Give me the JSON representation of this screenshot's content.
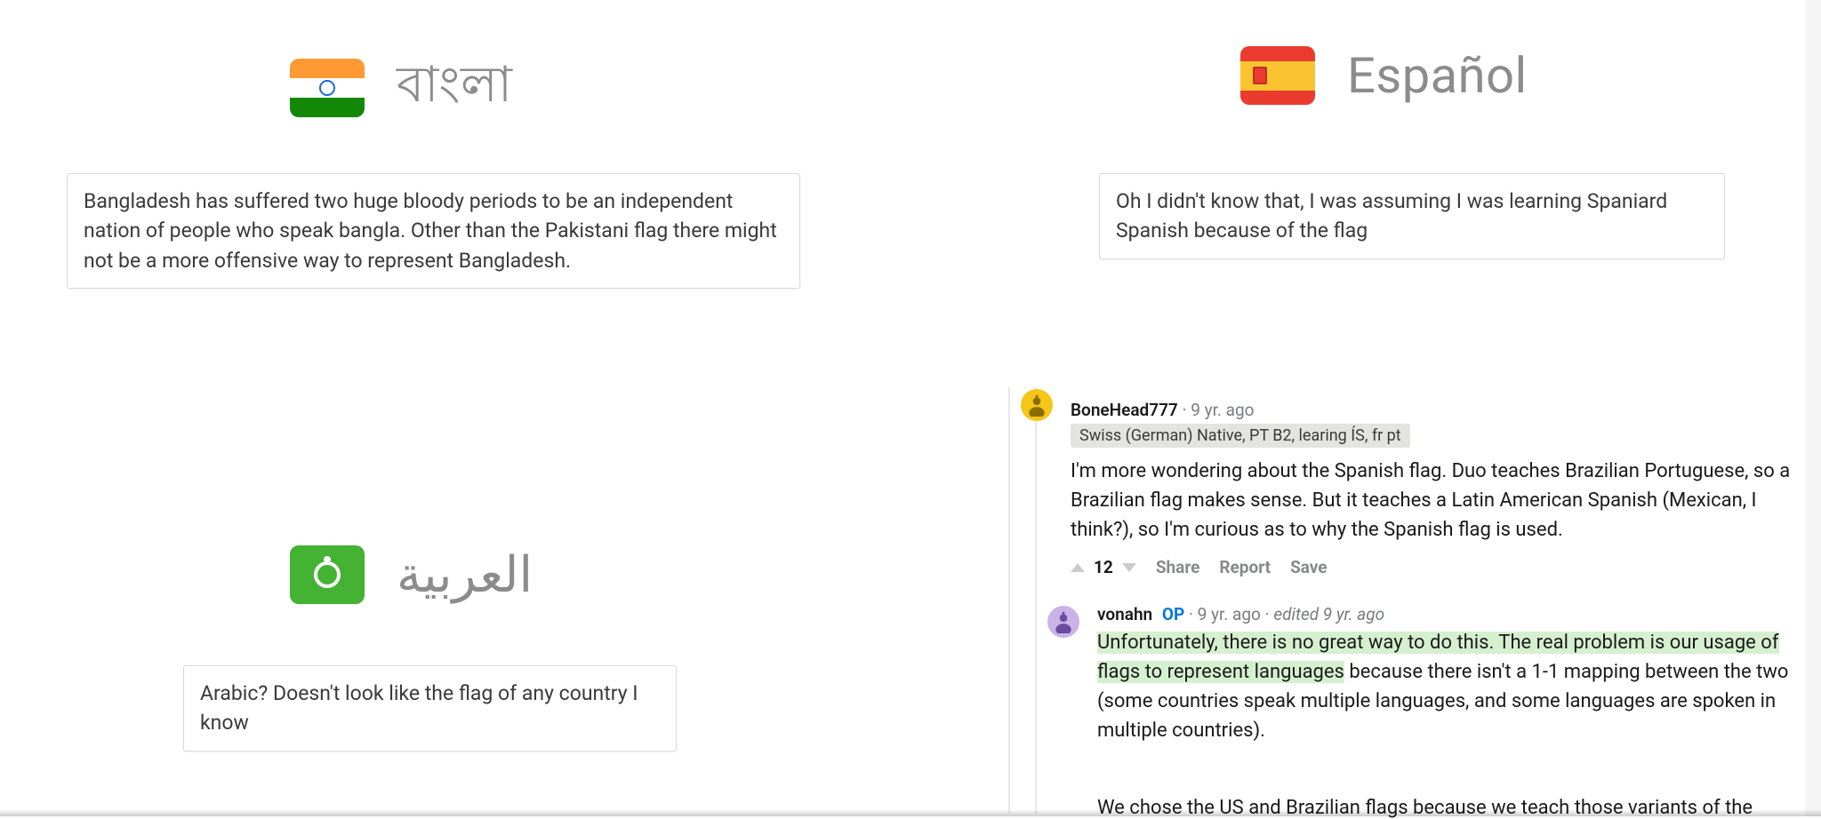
{
  "cards": {
    "bangla": {
      "label": "বাংলা"
    },
    "spanish": {
      "label": "Español"
    },
    "arabic": {
      "label": "العربية"
    }
  },
  "callouts": {
    "bangla": "Bangladesh has suffered two huge bloody periods to be an independent nation of people who speak bangla. Other than the Pakistani flag there might not be a more offensive way to represent Bangladesh.",
    "spanish": "Oh I didn't know that, I was assuming I was learning Spaniard Spanish because of the flag",
    "arabic": "Arabic? Doesn't look like the flag of any country I know"
  },
  "thread": {
    "c1": {
      "user": "BoneHead777",
      "age": "9 yr. ago",
      "flair": "Swiss (German) Native, PT B2, learing ÍS, fr pt",
      "body": "I'm more wondering about the Spanish flag. Duo teaches Brazilian Portuguese, so a Brazilian flag makes sense. But it teaches a Latin American Spanish (Mexican, I think?), so I'm curious as to why the Spanish flag is used.",
      "score": "12",
      "actions": {
        "share": "Share",
        "report": "Report",
        "save": "Save"
      }
    },
    "c2": {
      "user": "vonahn",
      "op": "OP",
      "age": "9 yr. ago",
      "edited": "edited 9 yr. ago",
      "hl": "Unfortunately, there is no great way to do this. The real problem is our usage of flags to represent languages",
      "rest": " because there isn't a 1-1 mapping between the two (some countries speak multiple languages, and some languages are spoken in multiple countries).",
      "truncated": "We chose the US and Brazilian flags because we teach those variants of the"
    }
  }
}
